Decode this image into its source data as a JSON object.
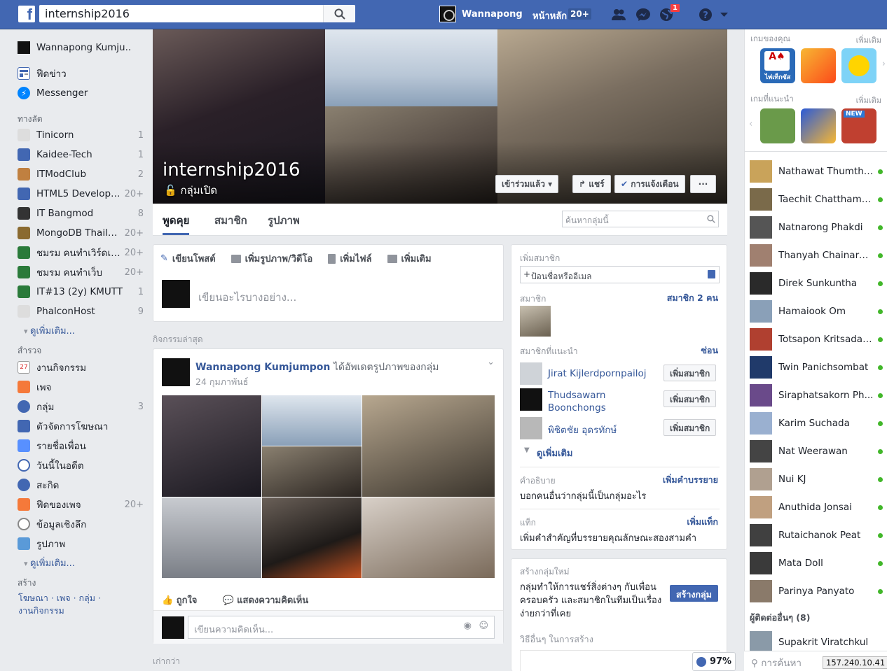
{
  "topbar": {
    "search_value": "internship2016",
    "user_name": "Wannapong",
    "home_label": "หน้าหลัก",
    "home_count": "20+",
    "notif_count": "1"
  },
  "left_nav": {
    "profile_name": "Wannapong Kumju..",
    "main_items": [
      {
        "label": "ฟีดข่าว"
      },
      {
        "label": "Messenger"
      }
    ],
    "shortcuts_heading": "ทางลัด",
    "shortcuts": [
      {
        "label": "Tinicorn",
        "count": "1"
      },
      {
        "label": "Kaidee-Tech",
        "count": "1"
      },
      {
        "label": "ITModClub",
        "count": "2"
      },
      {
        "label": "HTML5 Develope...",
        "count": "20+"
      },
      {
        "label": "IT Bangmod",
        "count": "8"
      },
      {
        "label": "MongoDB Thailand",
        "count": "20+"
      },
      {
        "label": "ชมรม คนทำเวิร์ดเพร...",
        "count": "20+"
      },
      {
        "label": "ชมรม คนทำเว็บ",
        "count": "20+"
      },
      {
        "label": "IT#13 (2y) KMUTT",
        "count": "1"
      },
      {
        "label": "PhalconHost",
        "count": "9"
      }
    ],
    "see_more_1": "ดูเพิ่มเติม...",
    "explore_heading": "สำรวจ",
    "explore": [
      {
        "label": "งานกิจกรรม",
        "count": ""
      },
      {
        "label": "เพจ",
        "count": ""
      },
      {
        "label": "กลุ่ม",
        "count": "3"
      },
      {
        "label": "ตัวจัดการโฆษณา",
        "count": ""
      },
      {
        "label": "รายชื่อเพื่อน",
        "count": ""
      },
      {
        "label": "วันนี้ในอดีต",
        "count": ""
      },
      {
        "label": "สะกิด",
        "count": ""
      },
      {
        "label": "ฟีดของเพจ",
        "count": "20+"
      },
      {
        "label": "ข้อมูลเชิงลึก",
        "count": ""
      },
      {
        "label": "รูปภาพ",
        "count": ""
      }
    ],
    "calendar_day": "27",
    "see_more_2": "ดูเพิ่มเติม...",
    "create_heading": "สร้าง",
    "create_links_1": "โฆษณา · เพจ · กลุ่ม ·",
    "create_links_2": "งานกิจกรรม"
  },
  "group": {
    "name": "internship2016",
    "privacy": "กลุ่มเปิด",
    "joined_button": "เข้าร่วมแล้ว",
    "share_button": "แชร์",
    "notif_button": "การแจ้งเตือน",
    "more_button": "···",
    "tabs": [
      "พูดคุย",
      "สมาชิก",
      "รูปภาพ"
    ],
    "search_placeholder": "ค้นหากลุ่มนี้"
  },
  "composer": {
    "tabs": [
      "เขียนโพสต์",
      "เพิ่มรูปภาพ/วิดีโอ",
      "เพิ่มไฟล์",
      "เพิ่มเติม"
    ],
    "placeholder": "เขียนอะไรบางอย่าง..."
  },
  "feed": {
    "recent_label": "กิจกรรมล่าสุด",
    "post": {
      "author": "Wannapong Kumjumpon",
      "action": "ได้อัพเดตรูปภาพของกลุ่ม",
      "date": "24 กุมภาพันธ์",
      "like": "ถูกใจ",
      "comment": "แสดงความคิดเห็น",
      "comment_placeholder": "เขียนความคิดเห็น..."
    },
    "older_label": "เก่ากว่า"
  },
  "members_panel": {
    "add_title": "เพิ่มสมาชิก",
    "add_placeholder": "ป้อนชื่อหรืออีเมล",
    "members_label": "สมาชิก",
    "members_count": "สมาชิก 2 คน",
    "suggested_label": "สมาชิกที่แนะนำ",
    "hide_label": "ซ่อน",
    "suggested": [
      {
        "name": "Jirat Kijlerdpornpailoj",
        "button": "เพิ่มสมาชิก"
      },
      {
        "name": "Thudsawarn Boonchongs",
        "button": "เพิ่มสมาชิก"
      },
      {
        "name": "พิชิตชัย อุดรทักษ์",
        "button": "เพิ่มสมาชิก"
      }
    ],
    "see_more": "ดูเพิ่มเติม",
    "desc_label": "คำอธิบาย",
    "desc_action": "เพิ่มคำบรรยาย",
    "desc_text": "บอกคนอื่นว่ากลุ่มนี้เป็นกลุ่มอะไร",
    "tags_label": "แท็ก",
    "tags_action": "เพิ่มแท็ก",
    "tags_text": "เพิ่มคำสำคัญที่บรรยายคุณลักษณะสองสามคำ"
  },
  "create_group": {
    "title": "สร้างกลุ่มใหม่",
    "text": "กลุ่มทำให้การแชร์สิ่งต่างๆ กับเพื่อน ครอบครัว และสมาชิกในทีมเป็นเรื่องง่ายกว่าที่เคย",
    "button": "สร้างกลุ่ม",
    "other_ways": "วิธีอื่นๆ ในการสร้าง"
  },
  "right_rail": {
    "games_label": "เกมของคุณ",
    "games_more": "เพิ่มเติม",
    "rec_label": "เกมที่แนะนำ",
    "rec_more": "เพิ่มเติม",
    "game1_text": "ไพ่เท็กซัส",
    "new_badge": "NEW",
    "contacts": [
      {
        "name": "Nathawat Thumthi...",
        "color": "#c9a35a"
      },
      {
        "name": "Taechit Chatthamp...",
        "color": "#7a6a4a"
      },
      {
        "name": "Natnarong Phakdi",
        "color": "#555"
      },
      {
        "name": "Thanyah Chainaron...",
        "color": "#a08070"
      },
      {
        "name": "Direk Sunkuntha",
        "color": "#2a2a2a"
      },
      {
        "name": "Hamaiook Om",
        "color": "#8aa0b8"
      },
      {
        "name": "Totsapon Kritsadan...",
        "color": "#b04030"
      },
      {
        "name": "Twin Panichsombat",
        "color": "#203a6a"
      },
      {
        "name": "Siraphatsakorn Ph...",
        "color": "#6a4a8a"
      },
      {
        "name": "Karim Suchada",
        "color": "#9ab0d0"
      },
      {
        "name": "Nat Weerawan",
        "color": "#444"
      },
      {
        "name": "Nui KJ",
        "color": "#b0a090"
      },
      {
        "name": "Anuthida Jonsai",
        "color": "#c0a080"
      },
      {
        "name": "Rutaichanok Peat",
        "color": "#404040"
      },
      {
        "name": "Mata Doll",
        "color": "#3a3a3a"
      },
      {
        "name": "Parinya Panyato",
        "color": "#8a7a6a"
      }
    ],
    "others_label": "ผู้ติดต่ออื่นๆ (8)",
    "other_contact": "Supakrit Viratchkul",
    "search_placeholder": "การค้นหา",
    "zoom": "97%",
    "ip": "157.240.10.41"
  }
}
